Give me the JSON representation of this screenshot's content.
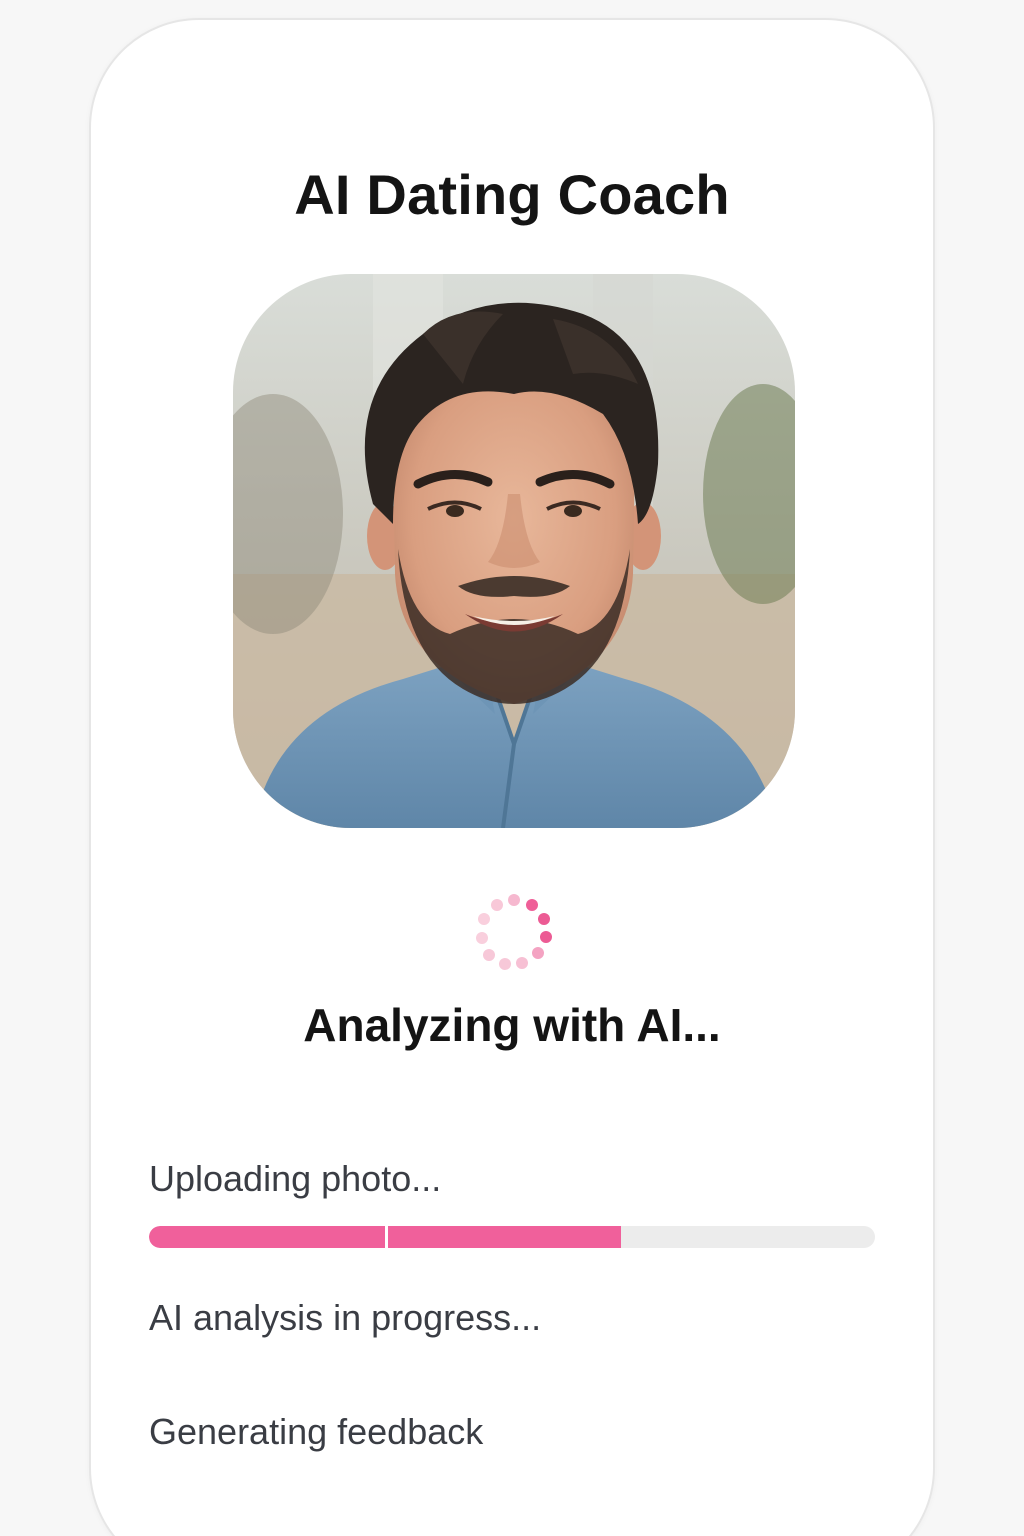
{
  "app": {
    "title": "AI Dating Coach"
  },
  "photo": {
    "alt": "Uploaded profile photo of a smiling bearded man in a denim shirt"
  },
  "status": {
    "heading": "Analyzing with AI...",
    "icon": "loading-spinner-icon"
  },
  "steps": [
    {
      "label": "Uploading photo...",
      "progress": 0.65
    },
    {
      "label": "AI analysis in progress..."
    },
    {
      "label": "Generating feedback"
    }
  ],
  "colors": {
    "accent": "#f0609b",
    "accent_light": "#f7b9d0",
    "track": "#ececec",
    "text_dark": "#141414",
    "text_muted": "#3a3d44"
  }
}
